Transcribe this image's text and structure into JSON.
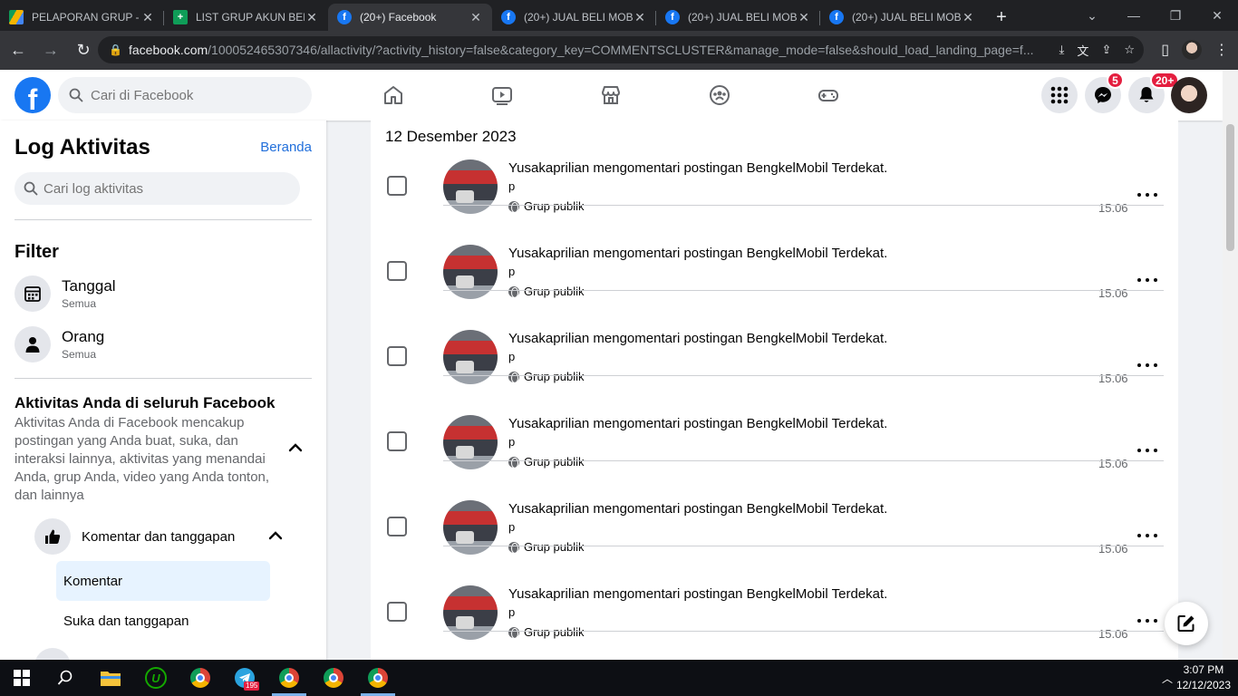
{
  "browser": {
    "tabs": [
      {
        "title": "PELAPORAN GRUP - G",
        "icon": "drive-icon",
        "active": false
      },
      {
        "title": "LIST GRUP AKUN BEN",
        "icon": "sheets-icon",
        "active": false
      },
      {
        "title": "(20+) Facebook",
        "icon": "facebook-icon",
        "active": true
      },
      {
        "title": "(20+) JUAL BELI MOB",
        "icon": "facebook-icon",
        "active": false
      },
      {
        "title": "(20+) JUAL BELI MOB",
        "icon": "facebook-icon",
        "active": false
      },
      {
        "title": "(20+) JUAL BELI MOB",
        "icon": "facebook-icon",
        "active": false
      }
    ],
    "url_host": "facebook.com",
    "url_rest": "/100052465307346/allactivity/?activity_history=false&category_key=COMMENTSCLUSTER&manage_mode=false&should_load_landing_page=f..."
  },
  "header": {
    "search_placeholder": "Cari di Facebook",
    "messenger_badge": "5",
    "notifications_badge": "20+"
  },
  "sidebar": {
    "title": "Log Aktivitas",
    "home_link": "Beranda",
    "search_placeholder": "Cari log aktivitas",
    "filter_title": "Filter",
    "filters": [
      {
        "label": "Tanggal",
        "value": "Semua"
      },
      {
        "label": "Orang",
        "value": "Semua"
      }
    ],
    "activity_title": "Aktivitas Anda di seluruh Facebook",
    "activity_desc": "Aktivitas Anda di Facebook mencakup postingan yang Anda buat, suka, dan interaksi lainnya, aktivitas yang menandai Anda, grup Anda, video yang Anda tonton, dan lainnya",
    "category": "Komentar dan tanggapan",
    "subitems": [
      "Komentar",
      "Suka dan tanggapan"
    ]
  },
  "main": {
    "date_header": "12 Desember 2023",
    "rows": [
      {
        "actor": "Yusakaprilian",
        "verb": " mengomentari postingan ",
        "target": "BengkelMobil Terdekat",
        "end": ".",
        "comment": "p",
        "audience": "Grup publik",
        "time": "15.06"
      },
      {
        "actor": "Yusakaprilian",
        "verb": " mengomentari postingan ",
        "target": "BengkelMobil Terdekat",
        "end": ".",
        "comment": "p",
        "audience": "Grup publik",
        "time": "15.06"
      },
      {
        "actor": "Yusakaprilian",
        "verb": " mengomentari postingan ",
        "target": "BengkelMobil Terdekat",
        "end": ".",
        "comment": "p",
        "audience": "Grup publik",
        "time": "15.06"
      },
      {
        "actor": "Yusakaprilian",
        "verb": " mengomentari postingan ",
        "target": "BengkelMobil Terdekat",
        "end": ".",
        "comment": "p",
        "audience": "Grup publik",
        "time": "15.06"
      },
      {
        "actor": "Yusakaprilian",
        "verb": " mengomentari postingan ",
        "target": "BengkelMobil Terdekat",
        "end": ".",
        "comment": "p",
        "audience": "Grup publik",
        "time": "15.06"
      },
      {
        "actor": "Yusakaprilian",
        "verb": " mengomentari postingan ",
        "target": "BengkelMobil Terdekat",
        "end": ".",
        "comment": "p",
        "audience": "Grup publik",
        "time": "15.06"
      }
    ]
  },
  "taskbar": {
    "telegram_badge": "195",
    "time": "3:07 PM",
    "date": "12/12/2023"
  },
  "colors": {
    "accent": "#1877f2",
    "badge": "#e41e3f",
    "link": "#216fdb"
  }
}
